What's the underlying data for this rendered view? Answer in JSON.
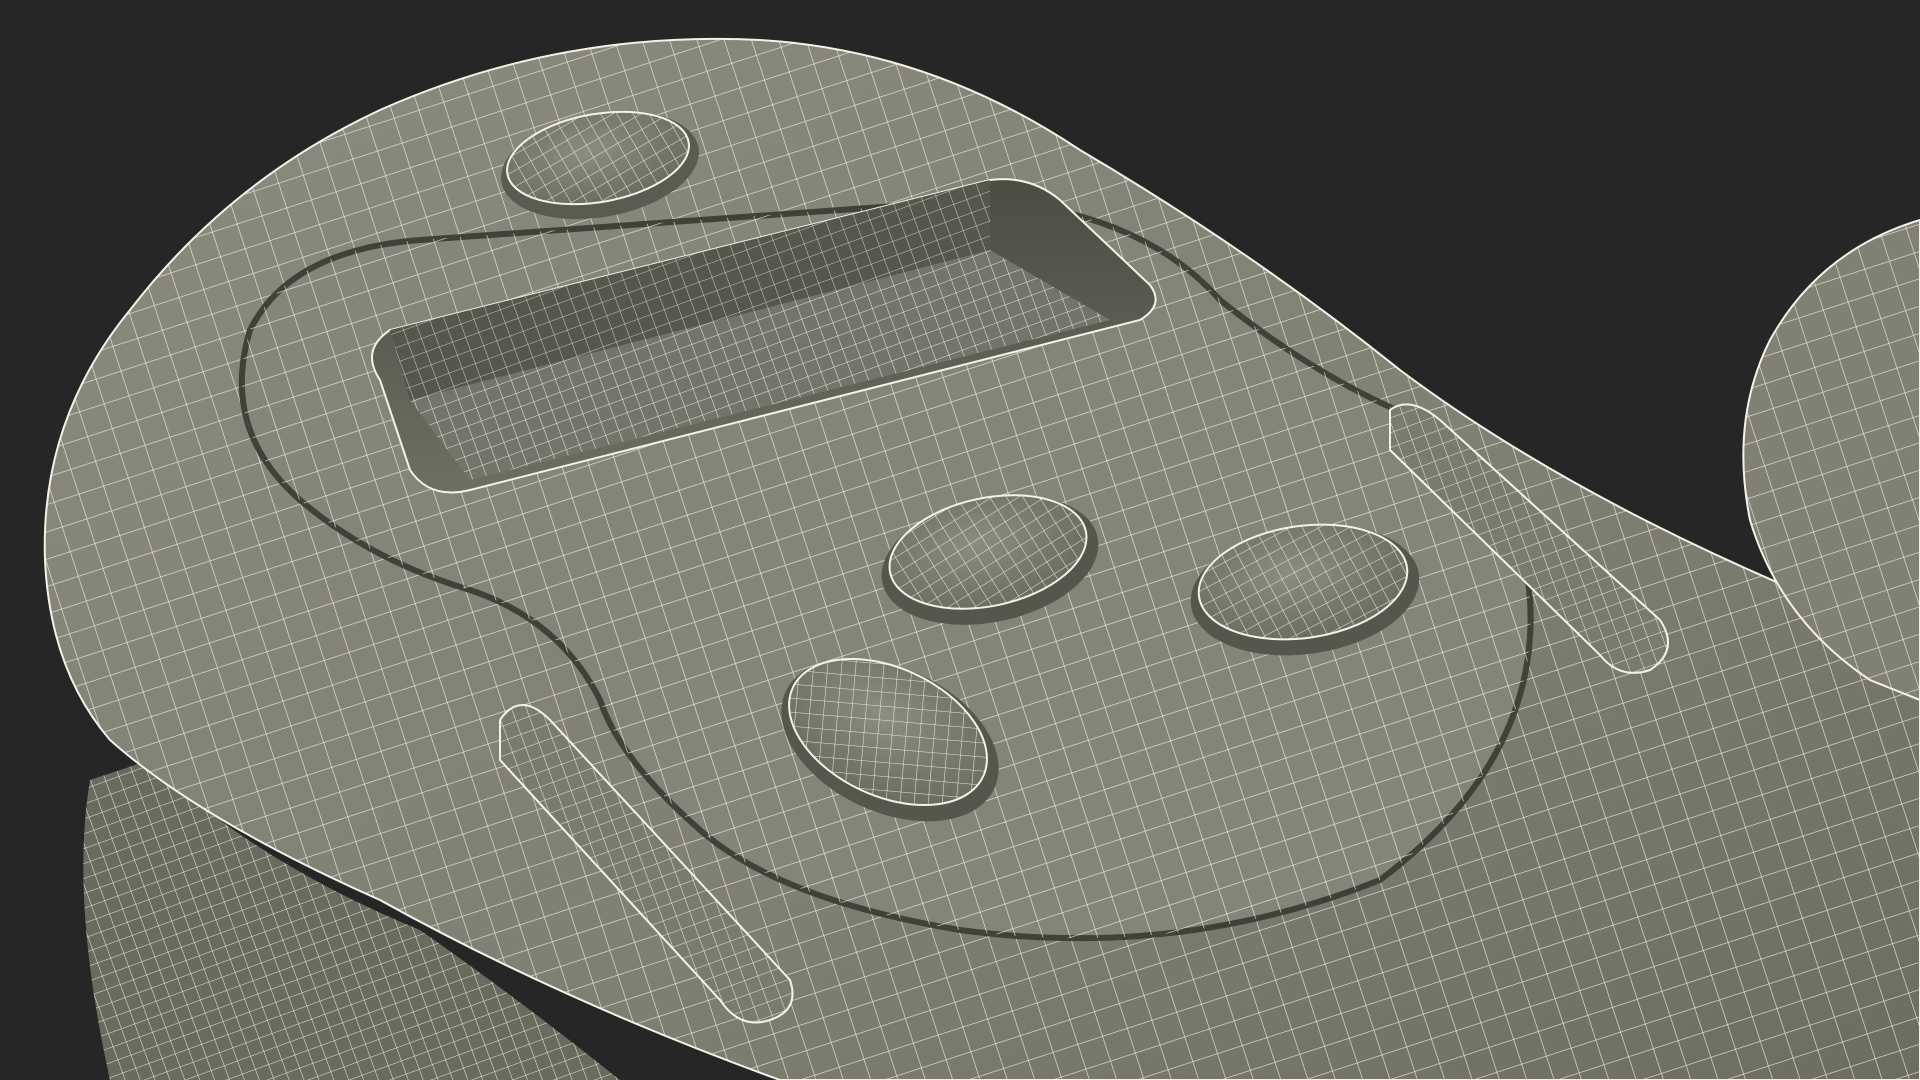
{
  "scene": {
    "background_color": "#262626",
    "surface_color": "#7f8073",
    "surface_light_color": "#8a8b7e",
    "surface_shadow_color": "#545549",
    "wire_color": "#f4f2e6"
  }
}
